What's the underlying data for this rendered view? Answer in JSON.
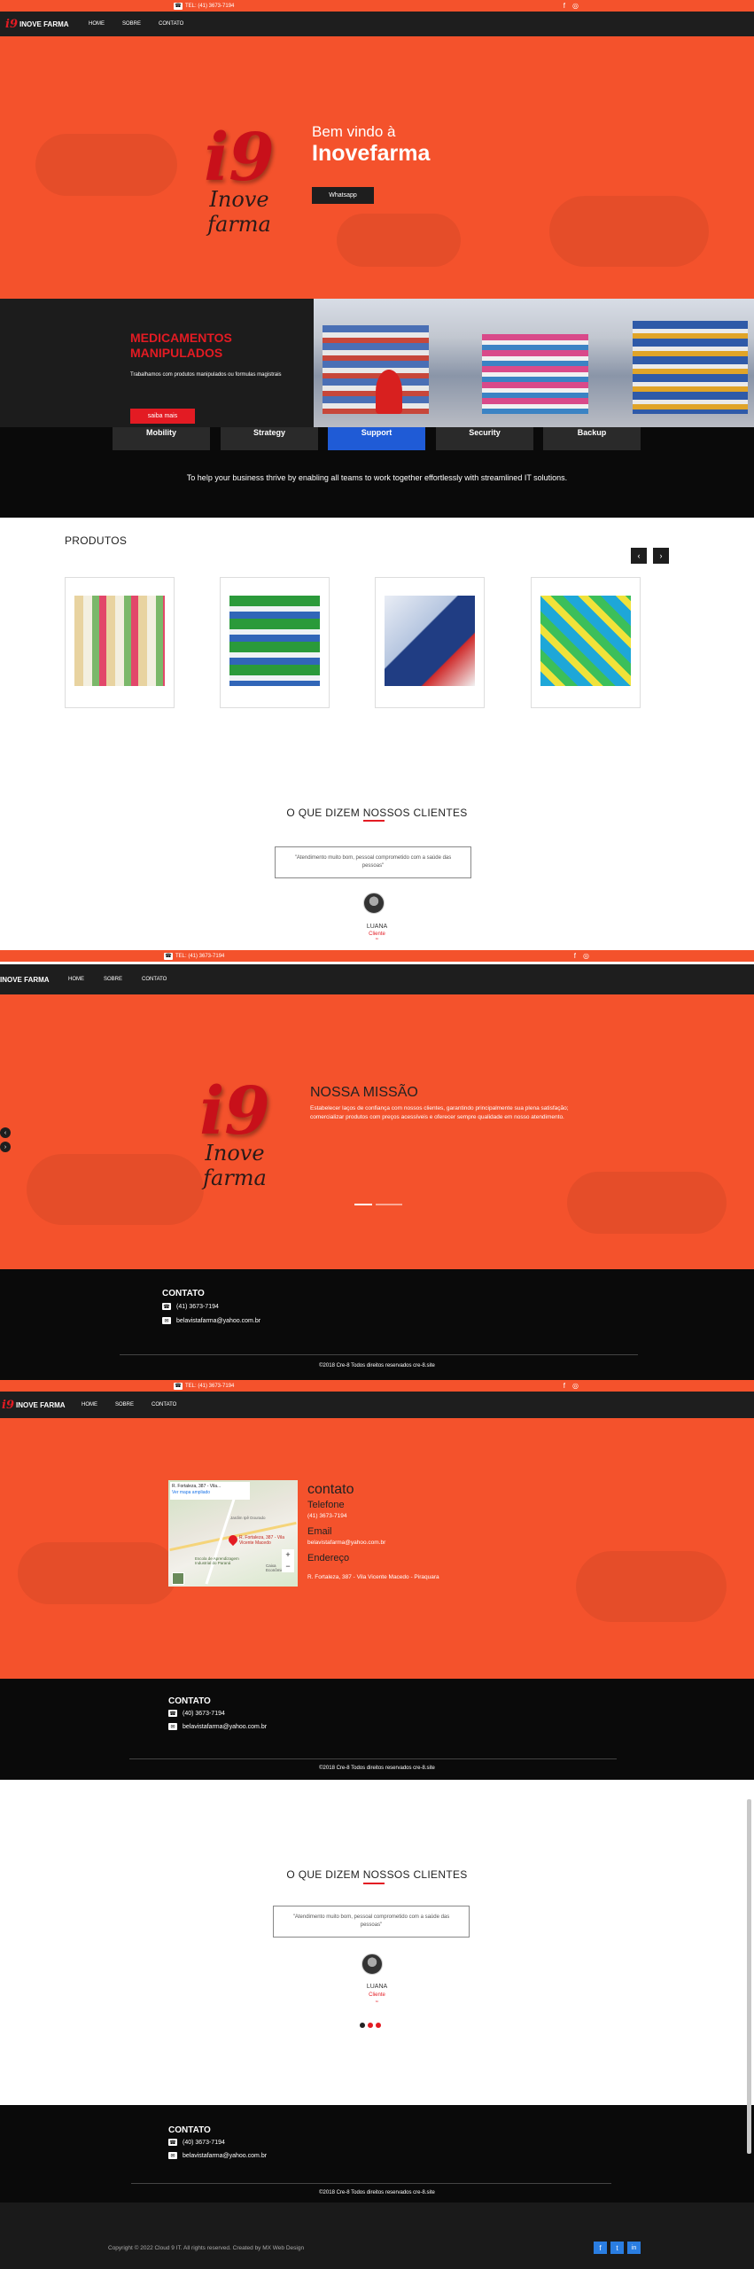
{
  "topbar": {
    "phone": "TEL: (41) 3673-7194",
    "phone2": "TEL: (41) 3673-7194"
  },
  "nav": {
    "brand": "INOVE FARMA",
    "home": "HOME",
    "sobre": "SOBRE",
    "contato": "CONTATO"
  },
  "hero": {
    "welcome": "Bem vindo à",
    "brand": "Inovefarma",
    "button": "Whatsapp"
  },
  "logo": {
    "mark": "i9",
    "name": "Inove farma"
  },
  "medicamentos": {
    "title": "MEDICAMENTOS MANIPULADOS",
    "text": "Trabalhamos com produtos manipulados ou formulas magistrais",
    "button": "saiba mais"
  },
  "tabs": [
    "Mobility",
    "Strategy",
    "Support",
    "Security",
    "Backup"
  ],
  "tagline": "To help your business thrive by enabling all teams to work together effortlessly with streamlined IT solutions.",
  "produtos": {
    "title": "PRODUTOS"
  },
  "clientes": {
    "title": "O QUE DIZEM NOSSOS CLIENTES",
    "quote": "\"Atendimento muito bom, pessoal comprometido com a saúde das pessoas\"",
    "name": "LUANA",
    "role": "Cliente",
    "quote_mark": "“"
  },
  "missao": {
    "title": "NOSSA MISSÃO",
    "text": "Estabelecer laços de confiança com nossos clientes, garantindo principalmente sua plena satisfação; comercializar produtos com preços acessíveis e oferecer sempre qualidade em nosso atendimento."
  },
  "contato_footer": {
    "title": "CONTATO",
    "phone": "(41) 3673-7194",
    "email": "belavistafarma@yahoo.com.br",
    "copy": "©2018 Cre-8 Todos direitos reservados cre-8.site",
    "phone_alt": "(40) 3673-7194",
    "phone_alt2": "(40) 3673-7194"
  },
  "contato_page": {
    "title": "contato",
    "tel_label": "Telefone",
    "tel": "(41) 3673-7194",
    "email_label": "Email",
    "email": "belavistafarma@yahoo.com.br",
    "end_label": "Endereço",
    "end": "R. Fortaleza, 387 - Vila Vicente Macedo - Piraquara"
  },
  "map": {
    "address_line1": "R. Fortaleza, 387 - Vila...",
    "address_line2": "Ver mapa ampliado",
    "pin_label": "R. Fortaleza, 387 - Vila Vicente Macedo",
    "poi1": "Escola de Aprendizagem Industrial do Paraná",
    "poi2": "Caixa Econômica",
    "road": "Jardim Ipê Dourado"
  },
  "bottom": {
    "copy": "Copyright © 2022 Cloud 9 IT. All rights reserved. Created by MX Web Design"
  },
  "colors": {
    "orange": "#f4522c",
    "red": "#e31b23",
    "dark": "#1e1e1e"
  }
}
